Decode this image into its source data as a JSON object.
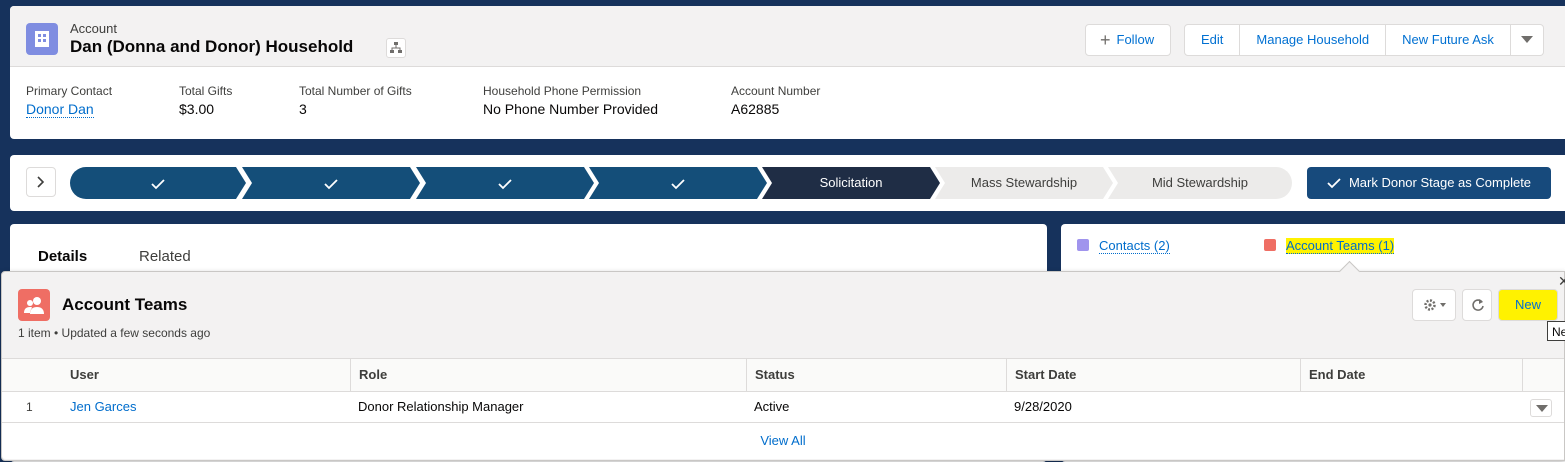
{
  "header": {
    "entity_label": "Account",
    "record_title": "Dan (Donna and Donor) Household",
    "buttons": {
      "follow": "Follow",
      "edit": "Edit",
      "manage_household": "Manage Household",
      "new_future_ask": "New Future Ask"
    },
    "fields": [
      {
        "label": "Primary Contact",
        "value": "Donor Dan"
      },
      {
        "label": "Total Gifts",
        "value": "$3.00"
      },
      {
        "label": "Total Number of Gifts",
        "value": "3"
      },
      {
        "label": "Household Phone Permission",
        "value": "No Phone Number Provided"
      },
      {
        "label": "Account Number",
        "value": "A62885"
      }
    ]
  },
  "path": {
    "stages": [
      {
        "label": "",
        "state": "complete"
      },
      {
        "label": "",
        "state": "complete"
      },
      {
        "label": "",
        "state": "complete"
      },
      {
        "label": "",
        "state": "complete"
      },
      {
        "label": "Solicitation",
        "state": "current"
      },
      {
        "label": "Mass Stewardship",
        "state": "incomplete"
      },
      {
        "label": "Mid Stewardship",
        "state": "incomplete"
      }
    ],
    "mark_complete_label": "Mark Donor Stage as Complete"
  },
  "tabs": {
    "details": "Details",
    "related": "Related"
  },
  "related_links": {
    "contacts": "Contacts (2)",
    "account_teams": "Account Teams (1)"
  },
  "popup": {
    "title": "Account Teams",
    "meta": "1 item • Updated a few seconds ago",
    "new_button": "New",
    "tooltip": "New",
    "columns": [
      "User",
      "Role",
      "Status",
      "Start Date",
      "End Date"
    ],
    "rows": [
      {
        "num": "1",
        "user": "Jen Garces",
        "role": "Donor Relationship Manager",
        "status": "Active",
        "start_date": "9/28/2020",
        "end_date": ""
      }
    ],
    "view_all": "View All"
  },
  "colors": {
    "brand_dark": "#16325c",
    "path_complete": "#144e79",
    "path_current": "#1f2d45",
    "highlight": "#fff200",
    "account_icon": "#7f8de1",
    "teams_icon": "#ef6e64"
  }
}
